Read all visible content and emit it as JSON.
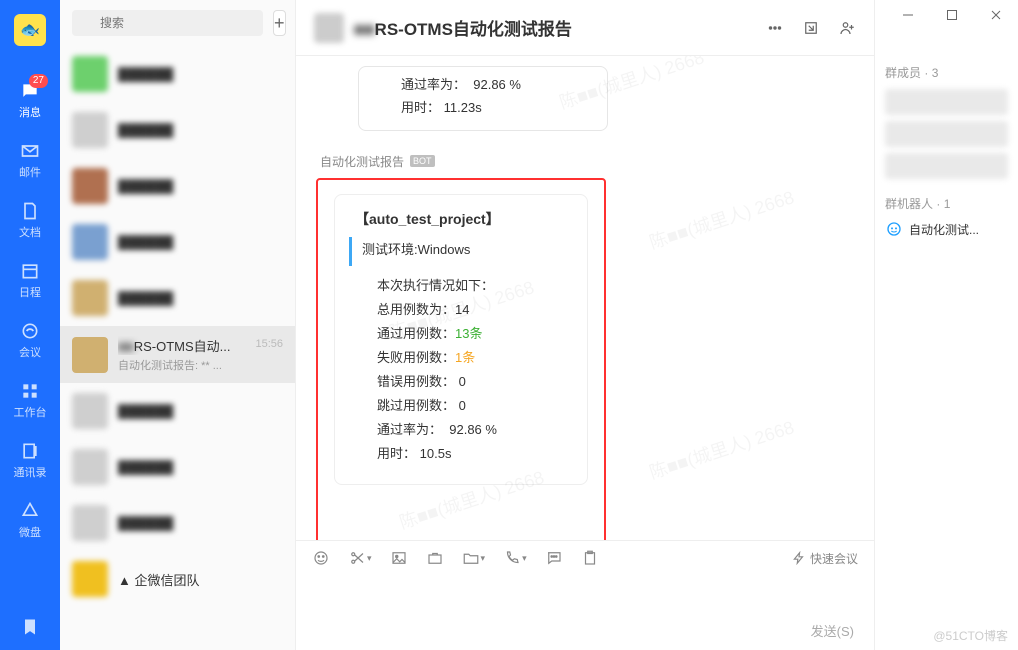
{
  "nav": {
    "items": [
      {
        "key": "messages",
        "label": "消息",
        "badge": "27",
        "active": true
      },
      {
        "key": "mail",
        "label": "邮件"
      },
      {
        "key": "docs",
        "label": "文档"
      },
      {
        "key": "calendar",
        "label": "日程"
      },
      {
        "key": "meeting",
        "label": "会议"
      },
      {
        "key": "workspace",
        "label": "工作台"
      },
      {
        "key": "contacts",
        "label": "通讯录"
      },
      {
        "key": "drive",
        "label": "微盘"
      }
    ]
  },
  "search": {
    "placeholder": "搜索"
  },
  "chat_list": {
    "items": [
      {
        "avatar_color": "#6dd06d"
      },
      {
        "avatar_color": "#cfcfcf"
      },
      {
        "avatar_color": "#b07050"
      },
      {
        "avatar_color": "#7aa0d0"
      },
      {
        "avatar_color": "#d0b070"
      },
      {
        "avatar_color": "#d0b070",
        "title": "RS-OTMS自动...",
        "subtitle": "自动化测试报告: ** ...",
        "time": "15:56",
        "selected": true
      },
      {
        "avatar_color": "#cfcfcf"
      },
      {
        "avatar_color": "#cfcfcf"
      },
      {
        "avatar_color": "#cfcfcf"
      },
      {
        "avatar_color": "#f0c020",
        "title_plain": "▲  企微信团队"
      }
    ]
  },
  "header": {
    "title_blurred_prefix": "■■",
    "title": "RS-OTMS自动化测试报告"
  },
  "previous_message": {
    "pass_rate_label": "通过率为：",
    "pass_rate_value": "92.86 %",
    "duration_label": "用时：",
    "duration_value": "11.23s"
  },
  "report": {
    "sender_name": "自动化测试报告",
    "bot_badge": "BOT",
    "project_title": "【auto_test_project】",
    "env_label": "测试环境:",
    "env_value": "Windows",
    "summary_heading": "本次执行情况如下：",
    "total_label": "总用例数为：",
    "total_value": "14",
    "pass_label": "通过用例数：",
    "pass_value": "13条",
    "fail_label": "失败用例数：",
    "fail_value": "1条",
    "error_label": "错误用例数：",
    "error_value": "0",
    "skip_label": "跳过用例数：",
    "skip_value": "0",
    "rate_label": "通过率为：",
    "rate_value": "92.86 %",
    "duration_label": "用时：",
    "duration_value": "10.5s"
  },
  "compose": {
    "quick_meeting": "快速会议",
    "send_button": "发送(S)"
  },
  "side": {
    "members_title_prefix": "群成员",
    "members_count": "3",
    "bots_title_prefix": "群机器人",
    "bots_count": "1",
    "bot_name": "自动化测试..."
  },
  "watermark_text": "陈■■(城里人) 2668",
  "attribution": "@51CTO博客"
}
